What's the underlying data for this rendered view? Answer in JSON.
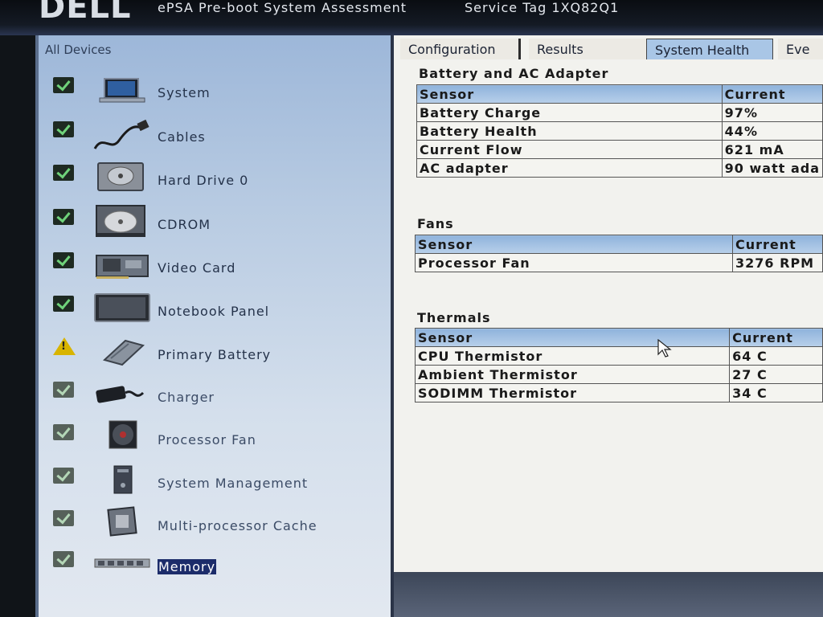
{
  "titlebar": {
    "logo": "DELL",
    "title": "ePSA Pre-boot System Assessment",
    "service_tag": "Service Tag 1XQ82Q1"
  },
  "devices": {
    "header": "All Devices",
    "items": [
      {
        "label": "System",
        "status": "pass",
        "icon": "laptop-icon"
      },
      {
        "label": "Cables",
        "status": "pass",
        "icon": "cable-icon"
      },
      {
        "label": "Hard Drive 0",
        "status": "pass",
        "icon": "hard-drive-icon"
      },
      {
        "label": "CDROM",
        "status": "pass",
        "icon": "cdrom-icon"
      },
      {
        "label": "Video Card",
        "status": "pass",
        "icon": "video-card-icon"
      },
      {
        "label": "Notebook Panel",
        "status": "pass",
        "icon": "notebook-panel-icon"
      },
      {
        "label": "Primary Battery",
        "status": "warning",
        "icon": "battery-icon"
      },
      {
        "label": "Charger",
        "status": "pass-dim",
        "icon": "charger-icon"
      },
      {
        "label": "Processor Fan",
        "status": "pass-dim",
        "icon": "fan-icon"
      },
      {
        "label": "System Management",
        "status": "pass-dim",
        "icon": "system-management-icon"
      },
      {
        "label": "Multi-processor Cache",
        "status": "pass-dim",
        "icon": "cpu-icon"
      },
      {
        "label": "Memory",
        "status": "pass-dim",
        "icon": "memory-icon",
        "selected": true
      }
    ]
  },
  "tabs": [
    {
      "label": "Configuration"
    },
    {
      "label": "Results"
    },
    {
      "label": "System Health",
      "active": true
    },
    {
      "label": "Eve"
    }
  ],
  "health": {
    "battery": {
      "title": "Battery and AC Adapter",
      "headers": [
        "Sensor",
        "Current"
      ],
      "rows": [
        [
          "Battery Charge",
          "97%"
        ],
        [
          "Battery Health",
          "44%"
        ],
        [
          "Current Flow",
          "621 mA"
        ],
        [
          "AC adapter",
          "90 watt ada"
        ]
      ]
    },
    "fans": {
      "title": "Fans",
      "headers": [
        "Sensor",
        "Current"
      ],
      "rows": [
        [
          "Processor Fan",
          "3276 RPM"
        ]
      ]
    },
    "thermals": {
      "title": "Thermals",
      "headers": [
        "Sensor",
        "Current"
      ],
      "rows": [
        [
          "CPU Thermistor",
          "64 C"
        ],
        [
          "Ambient Thermistor",
          "27 C"
        ],
        [
          "SODIMM Thermistor",
          "34 C"
        ]
      ]
    }
  },
  "colors": {
    "accent": "#1c2c6a",
    "check_pass": "#6fd27a",
    "warning": "#d8b400",
    "table_header": "#a9c6e6"
  }
}
